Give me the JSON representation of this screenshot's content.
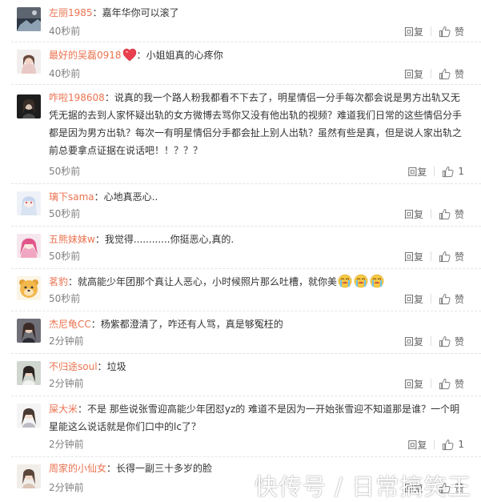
{
  "comments": [
    {
      "user": "左丽1985",
      "text": "嘉年华你可以滚了",
      "time": "40秒前",
      "reply": "回复",
      "like": "赞"
    },
    {
      "user": "最好的吴磊0918",
      "text": "小姐姐真的心疼你",
      "time": "40秒前",
      "reply": "回复",
      "like": "赞",
      "emoji": "heart-emoji"
    },
    {
      "user": "咋啦198608",
      "text": "说真的我一个路人粉我都看不下去了，明星情侣一分手每次都会说是男方出轨又无凭无据的去到人家怀疑出轨的女方微博去骂你又没有他出轨的视频？难道我们日常的这些情侣分手都是因为男方出轨？每次一有明星情侣分手都会扯上别人出轨？虽然有些是真，但是说人家出轨之前总要拿点证据在说话吧！！？？？",
      "time": "50秒前",
      "reply": "回复",
      "like": "1"
    },
    {
      "user": "璃下sama",
      "text": "心地真恶心..",
      "time": "50秒前",
      "reply": "回复",
      "like": "赞"
    },
    {
      "user": "五熊妹妹w",
      "text": "我觉得............你挺恶心,真的.",
      "time": "50秒前",
      "reply": "回复",
      "like": "赞"
    },
    {
      "user": "茗豹",
      "text": "就高能少年团那个真让人恶心，小时候照片那么吐槽，就你美",
      "time": "50秒前",
      "reply": "回复",
      "like": "赞",
      "emoji": "crying-emoji"
    },
    {
      "user": "杰尼龟CC",
      "text": "杨紫都澄清了，咋还有人骂，真是够冤枉的",
      "time": "2分钟前",
      "reply": "回复",
      "like": "赞"
    },
    {
      "user": "不归途soul",
      "text": "垃圾",
      "time": "2分钟前",
      "reply": "回复",
      "like": "赞"
    },
    {
      "user": "屎大米",
      "text": "不是 那些说张雪迎高能少年团怼yz的 难道不是因为一开始张雪迎不知道那是谁？一个明星能这么说话就是你们口中的lc了？",
      "time": "2分钟前",
      "reply": "回复",
      "like": "1"
    },
    {
      "user": "周家的小仙女",
      "text": "长得一副三十多岁的脸",
      "time": "2分钟前",
      "reply": "回复",
      "like": "赞"
    }
  ],
  "watermark": "快传号 / 日常搞笑王",
  "colors": {
    "username": "#eb7350",
    "meta": "#808080",
    "text": "#333333"
  }
}
